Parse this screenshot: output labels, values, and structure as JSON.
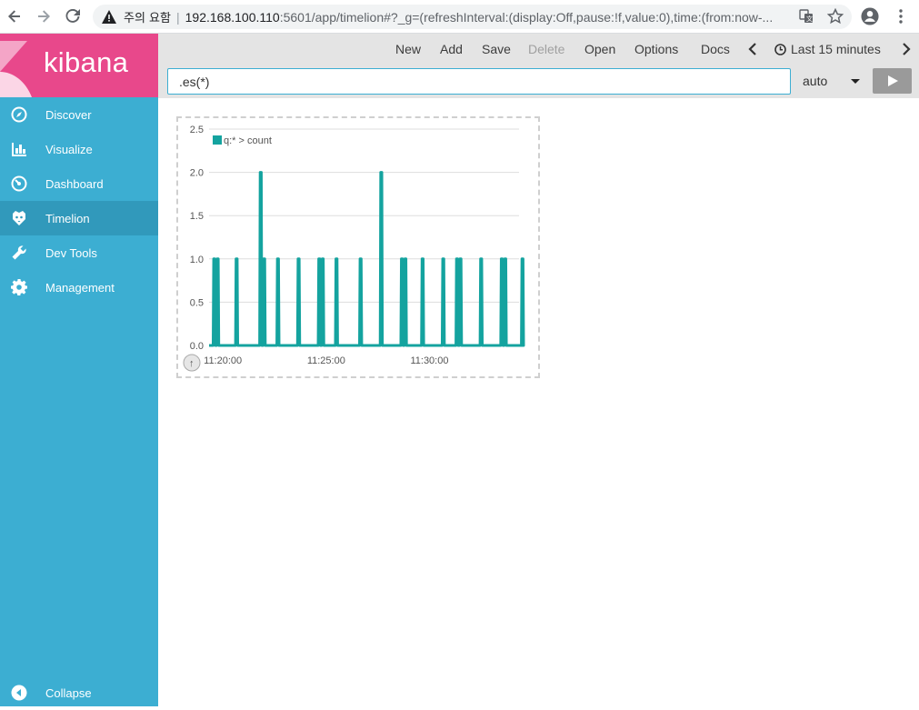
{
  "browser": {
    "security_label": "주의 요함",
    "url_host": "192.168.100.110",
    "url_rest": ":5601/app/timelion#?_g=(refreshInterval:(display:Off,pause:!f,value:0),time:(from:now-..."
  },
  "sidebar": {
    "logo": "kibana",
    "items": [
      {
        "label": "Discover",
        "icon": "compass-icon"
      },
      {
        "label": "Visualize",
        "icon": "bar-chart-icon"
      },
      {
        "label": "Dashboard",
        "icon": "gauge-icon"
      },
      {
        "label": "Timelion",
        "icon": "timelion-icon"
      },
      {
        "label": "Dev Tools",
        "icon": "wrench-icon"
      },
      {
        "label": "Management",
        "icon": "gear-icon"
      }
    ],
    "active_item": "Timelion",
    "collapse_label": "Collapse"
  },
  "topnav": {
    "new": "New",
    "add": "Add",
    "save": "Save",
    "delete": "Delete",
    "open": "Open",
    "options": "Options",
    "docs": "Docs",
    "time_range": "Last 15 minutes"
  },
  "query": {
    "expression": ".es(*)",
    "interval": "auto"
  },
  "chart_data": {
    "type": "line",
    "legend": [
      "q:* > count"
    ],
    "series_color": "#14a39f",
    "ylim": [
      0,
      2.5
    ],
    "y_ticks": [
      "0.0",
      "0.5",
      "1.0",
      "1.5",
      "2.0",
      "2.5"
    ],
    "x_ticks": [
      "11:20:00",
      "11:25:00",
      "11:30:00"
    ],
    "series": [
      {
        "name": "q:* > count",
        "x": [
          "11:19:35",
          "11:19:45",
          "11:20:40",
          "11:21:50",
          "11:22:00",
          "11:22:40",
          "11:23:40",
          "11:24:40",
          "11:24:50",
          "11:25:30",
          "11:26:40",
          "11:27:40",
          "11:28:40",
          "11:28:50",
          "11:29:40",
          "11:30:40",
          "11:31:20",
          "11:31:30",
          "11:32:30",
          "11:33:30",
          "11:33:40",
          "11:34:30"
        ],
        "values": [
          1,
          1,
          1,
          2,
          1,
          1,
          1,
          1,
          1,
          1,
          1,
          2,
          1,
          1,
          1,
          1,
          1,
          1,
          1,
          1,
          1,
          1
        ]
      }
    ]
  }
}
